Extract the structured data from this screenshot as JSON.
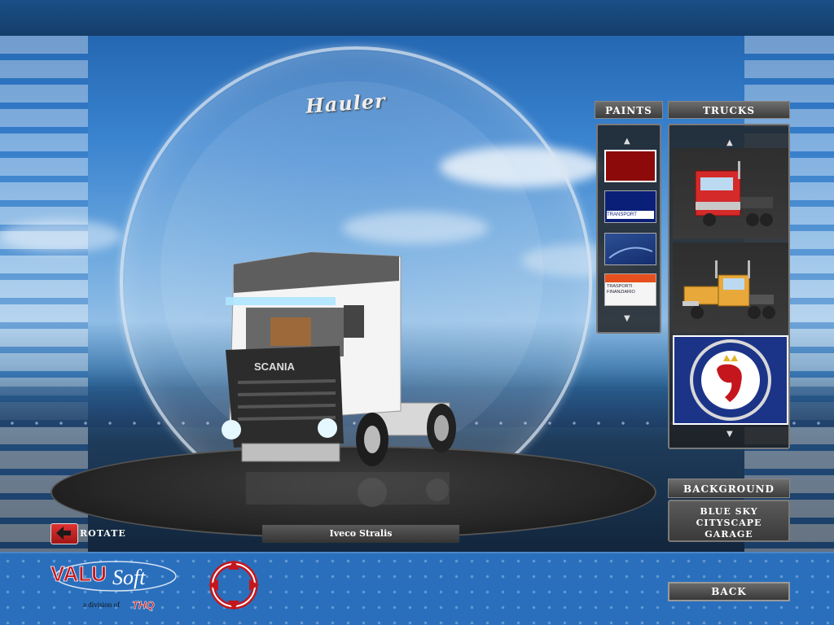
{
  "rotate": {
    "label": "ROTATE"
  },
  "current_truck": {
    "name": "Iveco Stralis"
  },
  "ring_logo": {
    "text": "Hauler"
  },
  "paints": {
    "header": "PAINTS",
    "items": [
      {
        "color": "#8c0a0a"
      },
      {
        "color": "#0a1f78",
        "text": "TRANSPORT"
      },
      {
        "color": "#1b3c7c"
      },
      {
        "color": "#f5f5f5",
        "text": "TRASPORTI FINANZIARIO"
      }
    ]
  },
  "trucks": {
    "header": "TRUCKS",
    "items": [
      {
        "name": "red-cabover-truck",
        "color": "#d42a2a"
      },
      {
        "name": "yellow-conventional-truck",
        "color": "#e8a93a"
      },
      {
        "name": "scania-griffin-logo",
        "color": "#1b3488"
      }
    ]
  },
  "background": {
    "header": "BACKGROUND",
    "options": [
      "BLUE SKY",
      "CITYSCAPE",
      "GARAGE"
    ]
  },
  "back": {
    "label": "BACK"
  },
  "branding": {
    "valu": "VALU",
    "soft": "Soft",
    "division": "a division of",
    "thq": "THQ"
  },
  "truck_grille": {
    "brand": "SCANIA"
  }
}
